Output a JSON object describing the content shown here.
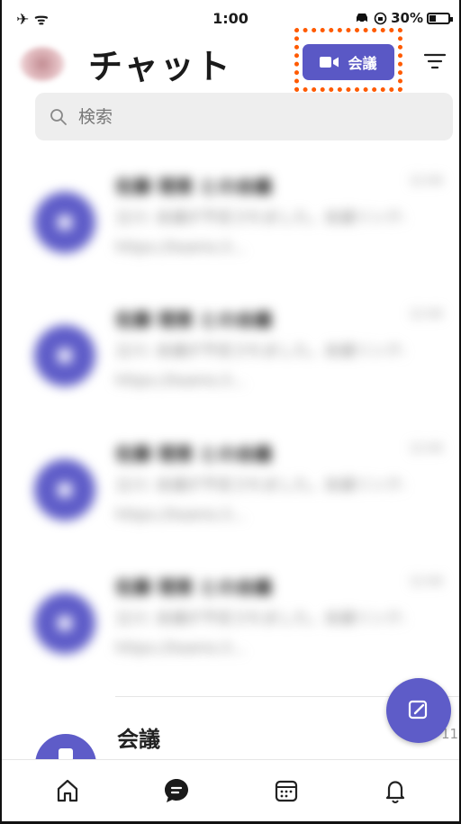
{
  "status_bar": {
    "left": "✈ ᯤ",
    "time": "1:00",
    "battery": "30%"
  },
  "header": {
    "title": "チャット",
    "meet_button": "会議"
  },
  "search": {
    "placeholder": "検索"
  },
  "chats": [
    {
      "name": "佐藤 理恵 との会議",
      "time": "12:00",
      "preview": "立川: 会議が予定されました。会議リンク: https://teams.li..."
    },
    {
      "name": "佐藤 理恵 との会議",
      "time": "12:00",
      "preview": "立川: 会議が予定されました。会議リンク: https://teams.li..."
    },
    {
      "name": "佐藤 理恵 との会議",
      "time": "12:00",
      "preview": "立川: 会議が予定されました。会議リンク: https://teams.li..."
    },
    {
      "name": "佐藤 理恵 との会議",
      "time": "12:00",
      "preview": "立川: 会議が予定されました。会議リンク: https://teams.li..."
    }
  ],
  "meeting_row": {
    "label": "会議",
    "time": "11"
  },
  "colors": {
    "accent": "#5e5cc8",
    "focus_ring": "#ff5a00"
  },
  "tabs": [
    {
      "icon": "home-icon"
    },
    {
      "icon": "chat-icon"
    },
    {
      "icon": "calendar-icon"
    },
    {
      "icon": "bell-icon"
    }
  ]
}
